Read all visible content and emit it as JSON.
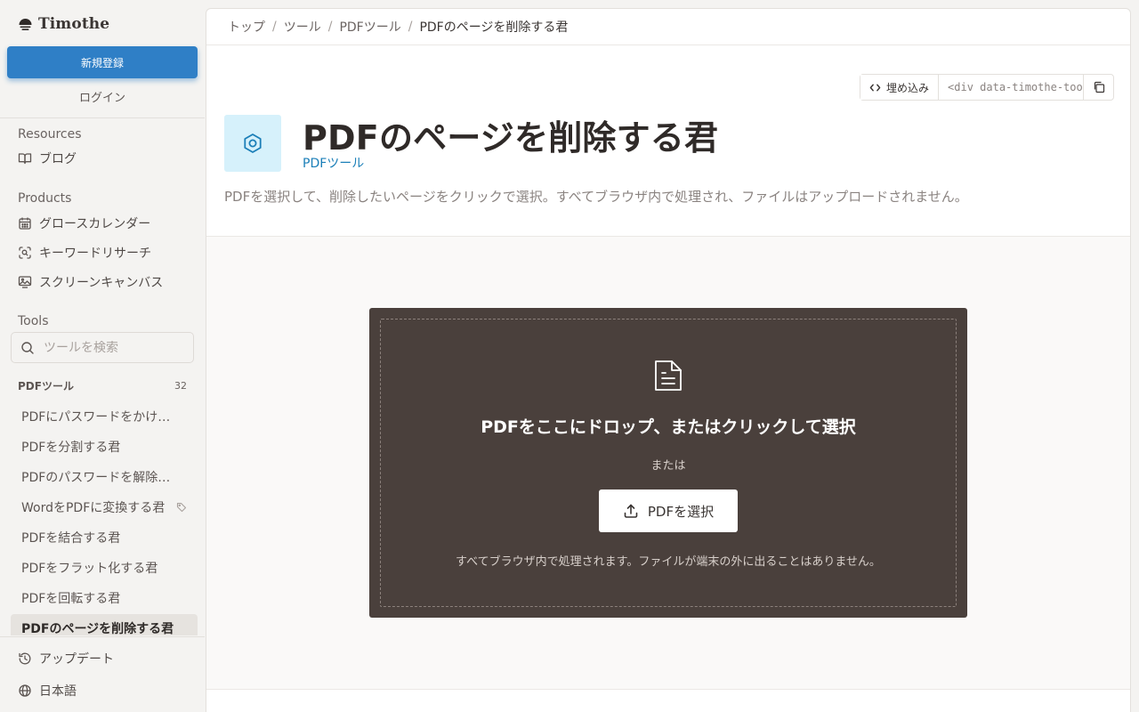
{
  "sidebar": {
    "brand": "Timothe",
    "signup_label": "新規登録",
    "login_label": "ログイン",
    "resources": {
      "heading": "Resources",
      "items": [
        {
          "label": "ブログ",
          "icon": "book-open-icon"
        }
      ]
    },
    "products": {
      "heading": "Products",
      "items": [
        {
          "label": "グロースカレンダー",
          "icon": "calendar-icon"
        },
        {
          "label": "キーワードリサーチ",
          "icon": "scan-search-icon"
        },
        {
          "label": "スクリーンキャンバス",
          "icon": "image-screen-icon"
        }
      ]
    },
    "tools": {
      "heading": "Tools",
      "search_placeholder": "ツールを検索",
      "category_label": "PDFツール",
      "category_count": "32",
      "items": [
        {
          "label": "PDFにパスワードをかける君"
        },
        {
          "label": "PDFを分割する君"
        },
        {
          "label": "PDFのパスワードを解除する君"
        },
        {
          "label": "WordをPDFに変換する君",
          "icon": "tag-icon"
        },
        {
          "label": "PDFを結合する君"
        },
        {
          "label": "PDFをフラット化する君"
        },
        {
          "label": "PDFを回転する君"
        },
        {
          "label": "PDFのページを削除する君",
          "active": true
        }
      ]
    },
    "footer": {
      "updates_label": "アップデート",
      "language_label": "日本語"
    }
  },
  "breadcrumb": {
    "items": [
      "トップ",
      "ツール",
      "PDFツール"
    ],
    "current": "PDFのページを削除する君"
  },
  "embed": {
    "button_label": "埋め込み",
    "code": "<div data-timothe-tool=\"pdf-delete-pages\"></div>"
  },
  "tool": {
    "title": "PDFのページを削除する君",
    "category": "PDFツール",
    "description": "PDFを選択して、削除したいページをクリックで選択。すべてブラウザ内で処理され、ファイルはアップロードされません。"
  },
  "dropzone": {
    "title": "PDFをここにドロップ、またはクリックして選択",
    "or_label": "または",
    "button_label": "PDFを選択",
    "note": "すべてブラウザ内で処理されます。ファイルが端末の外に出ることはありません。"
  },
  "colors": {
    "primary": "#2f7fc6",
    "link": "#1b7fb8",
    "dropzone_bg": "#4a403c",
    "icon_tile": "#d6f1fb"
  }
}
